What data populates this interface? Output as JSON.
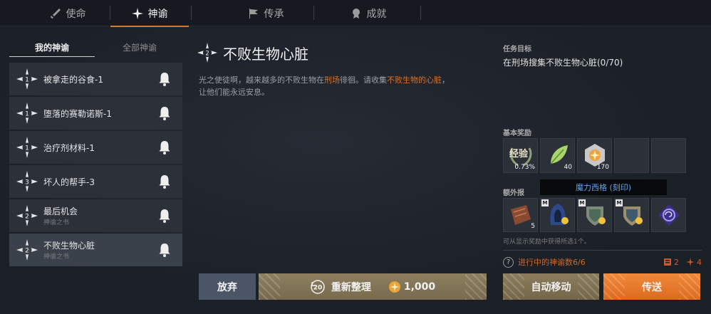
{
  "top_tabs": [
    {
      "label": "使命",
      "icon": "sword-icon"
    },
    {
      "label": "神谕",
      "icon": "oracle-star-icon"
    },
    {
      "label": "传承",
      "icon": "flag-icon"
    },
    {
      "label": "成就",
      "icon": "medal-icon"
    }
  ],
  "sub_tabs": {
    "mine": "我的神谕",
    "all": "全部神谕"
  },
  "quests": [
    {
      "name": "被拿走的谷食-1",
      "sub": "",
      "level": "1"
    },
    {
      "name": "堕落的赛勒诺斯-1",
      "sub": "",
      "level": "1"
    },
    {
      "name": "治疗剂材料-1",
      "sub": "",
      "level": "1"
    },
    {
      "name": "坏人的帮手-3",
      "sub": "",
      "level": "3"
    },
    {
      "name": "最后机会",
      "sub": "神谕之书",
      "level": "2"
    },
    {
      "name": "不败生物心脏",
      "sub": "神谕之书",
      "level": "2"
    }
  ],
  "detail": {
    "level": "2",
    "title": "不败生物心脏",
    "desc_1": "光之使徒啊，越来越多的不败生物在",
    "desc_hl1": "刑场",
    "desc_2": "徘徊。请收集",
    "desc_hl2": "不败生物的心脏",
    "desc_3": "，",
    "desc_4": "让他们能永远安息。"
  },
  "objective": {
    "label": "任务目标",
    "text": "在刑场搜集不败生物心脏(0/70)"
  },
  "basic_rewards": {
    "label": "基本奖励",
    "items": [
      {
        "icon": "exp-laurel-icon",
        "badge": "经验",
        "count": "0.73%"
      },
      {
        "icon": "green-leaf-icon",
        "count": "40"
      },
      {
        "icon": "gold-crystal-icon",
        "count": "170"
      },
      {
        "icon": "empty-slot",
        "count": ""
      },
      {
        "icon": "empty-slot",
        "count": ""
      }
    ]
  },
  "extra_rewards": {
    "label": "额外报",
    "tooltip": "魔力西格 (刻印)",
    "items": [
      {
        "icon": "scroll-icon",
        "count": "5",
        "badge": ""
      },
      {
        "icon": "blue-hood-icon",
        "count": "",
        "badge": "M"
      },
      {
        "icon": "green-shield-icon",
        "count": "",
        "badge": "M"
      },
      {
        "icon": "gold-shield-icon",
        "count": "",
        "badge": "M"
      },
      {
        "icon": "purple-sigil-icon",
        "count": "",
        "badge": ""
      }
    ],
    "note": "可从显示奖励中获得所选1个。"
  },
  "progress": {
    "text": "进行中的神谕数6/6",
    "counter1": "2",
    "counter2": "4"
  },
  "buttons": {
    "abandon": "放弃",
    "refresh": "重新整理",
    "refresh_count": "20",
    "refresh_cost": "1,000",
    "auto_move": "自动移动",
    "teleport": "传送"
  },
  "colors": {
    "accent": "#d9792c",
    "highlight": "#d8702c",
    "tooltip_text": "#5fa7f2"
  }
}
